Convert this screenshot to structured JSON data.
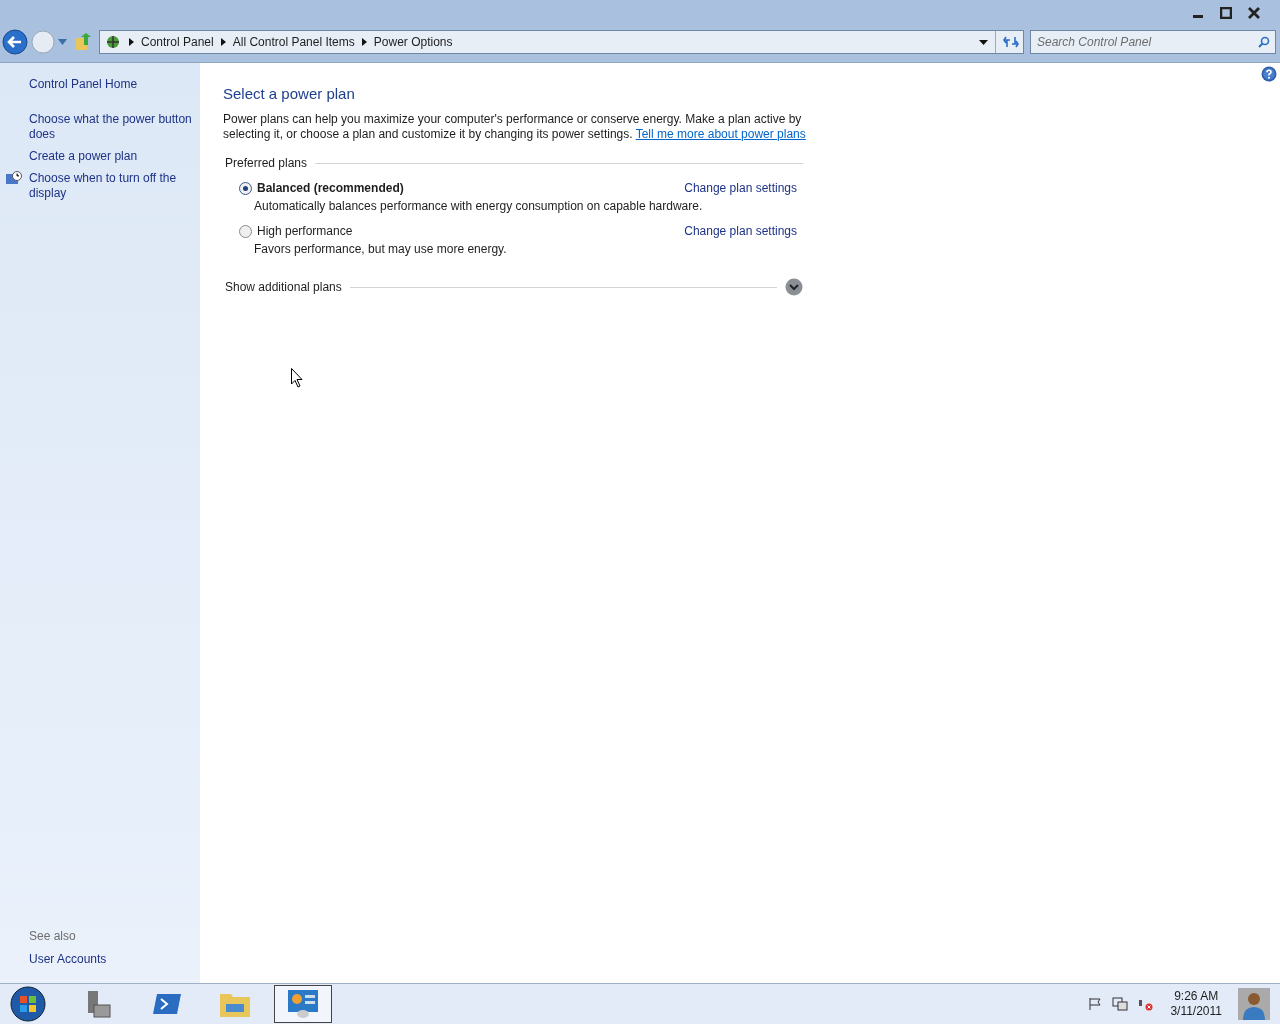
{
  "address_bar": {
    "breadcrumbs": [
      "Control Panel",
      "All Control Panel Items",
      "Power Options"
    ],
    "search": {
      "placeholder": "Search Control Panel"
    }
  },
  "sidebar": {
    "items": [
      {
        "label": "Control Panel Home",
        "icon": false
      },
      {
        "label": "Choose what the power button does",
        "icon": false
      },
      {
        "label": "Create a power plan",
        "icon": false
      },
      {
        "label": "Choose when to turn off the display",
        "icon": true
      }
    ],
    "see_also_title": "See also",
    "see_also": [
      "User Accounts"
    ]
  },
  "main": {
    "title": "Select a power plan",
    "intro": "Power plans can help you maximize your computer's performance or conserve energy. Make a plan active by selecting it, or choose a plan and customize it by changing its power settings.",
    "intro_link": "Tell me more about power plans",
    "group_title": "Preferred plans",
    "plans": [
      {
        "name": "Balanced (recommended)",
        "description": "Automatically balances performance with energy consumption on capable hardware.",
        "link": "Change plan settings",
        "selected": true
      },
      {
        "name": "High performance",
        "description": "Favors performance, but may use more energy.",
        "link": "Change plan settings",
        "selected": false
      }
    ],
    "more_plans": "Show additional plans"
  },
  "taskbar": {
    "items": [
      {
        "kind": "server",
        "selected": false
      },
      {
        "kind": "powershell",
        "selected": false
      },
      {
        "kind": "explorer",
        "selected": false
      },
      {
        "kind": "controlpanel",
        "selected": true
      }
    ],
    "time": "9:26 AM",
    "date": "3/11/2011"
  }
}
